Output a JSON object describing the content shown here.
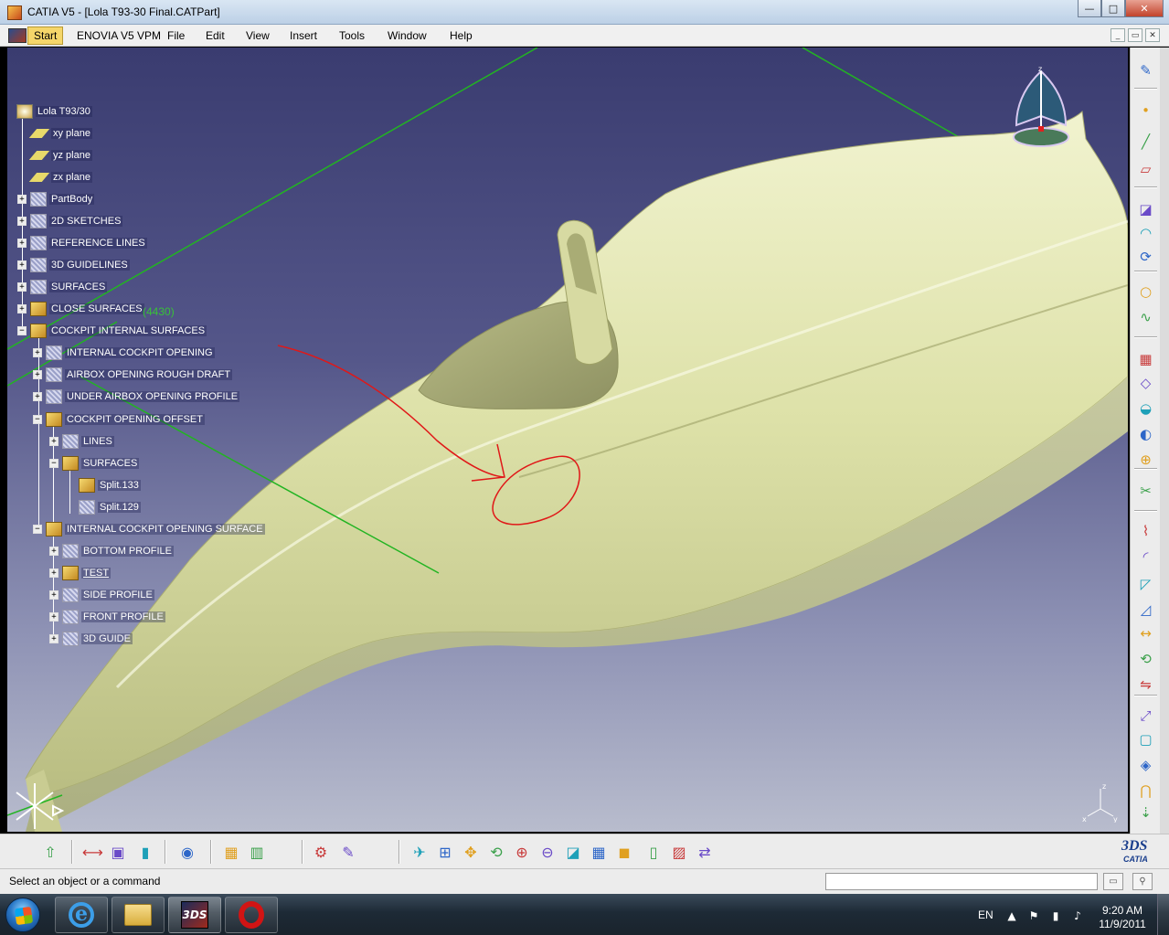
{
  "window": {
    "title": "CATIA V5 - [Lola T93-30 Final.CATPart]",
    "controls": {
      "minimize": "—",
      "maximize": "□",
      "close": "✕"
    }
  },
  "menubar": {
    "items": [
      "Start",
      "ENOVIA V5 VPM",
      "File",
      "Edit",
      "View",
      "Insert",
      "Tools",
      "Window",
      "Help"
    ],
    "doc_controls": [
      "_",
      "▭",
      "✕"
    ]
  },
  "spec_tree": {
    "root": "Lola T93/30",
    "nodes": [
      {
        "label": "xy plane",
        "type": "plane"
      },
      {
        "label": "yz plane",
        "type": "plane"
      },
      {
        "label": "zx plane",
        "type": "plane"
      },
      {
        "label": "PartBody",
        "type": "body",
        "expander": "+"
      },
      {
        "label": "2D SKETCHES",
        "type": "geoset-hatched",
        "expander": "+"
      },
      {
        "label": "REFERENCE LINES",
        "type": "geoset-hatched",
        "expander": "+"
      },
      {
        "label": "3D GUIDELINES",
        "type": "geoset-hatched",
        "expander": "+"
      },
      {
        "label": "SURFACES",
        "type": "geoset-hatched",
        "expander": "+"
      },
      {
        "label": "CLOSE SURFACES",
        "type": "geoset",
        "expander": "+"
      },
      {
        "label": "COCKPIT INTERNAL SURFACES",
        "type": "geoset",
        "expander": "−"
      },
      {
        "label": "INTERNAL COCKPIT OPENING",
        "type": "geoset-hatched",
        "expander": "+"
      },
      {
        "label": "AIRBOX OPENING ROUGH DRAFT",
        "type": "geoset-hatched",
        "expander": "+"
      },
      {
        "label": "UNDER AIRBOX OPENING PROFILE",
        "type": "geoset-hatched",
        "expander": "+"
      },
      {
        "label": "COCKPIT OPENING OFFSET",
        "type": "geoset",
        "expander": "−"
      },
      {
        "label": "LINES",
        "type": "geoset-hatched",
        "expander": "+"
      },
      {
        "label": "SURFACES",
        "type": "geoset",
        "expander": "−"
      },
      {
        "label": "Split.133",
        "type": "feature"
      },
      {
        "label": "Split.129",
        "type": "feature-hatched"
      },
      {
        "label": "INTERNAL COCKPIT OPENING SURFACE",
        "type": "geoset",
        "expander": "−"
      },
      {
        "label": "BOTTOM PROFILE",
        "type": "geoset-hatched",
        "expander": "+"
      },
      {
        "label": "TEST",
        "type": "geoset",
        "expander": "+"
      },
      {
        "label": "SIDE PROFILE",
        "type": "geoset-hatched",
        "expander": "+"
      },
      {
        "label": "FRONT PROFILE",
        "type": "geoset-hatched",
        "expander": "+"
      },
      {
        "label": "3D GUIDE",
        "type": "geoset-hatched",
        "expander": "+"
      }
    ],
    "overlay_count": "(4430)"
  },
  "viewport": {
    "compass_label": "z",
    "axis_labels": {
      "z": "z",
      "x": "x",
      "y": "y"
    },
    "colors": {
      "surface": "#e2e6b0",
      "guide_lines": "#22b422",
      "annotation": "#e01818",
      "bg_top": "#3a3c70",
      "bg_bottom": "#b8bccd"
    }
  },
  "right_toolbar": {
    "icons": [
      "sketch-icon",
      "point-icon",
      "line-icon",
      "plane-icon",
      "extrude-icon",
      "revolve-icon",
      "sweep-icon",
      "circle-icon",
      "spline-icon",
      "fill-icon",
      "loft-icon",
      "blend-icon",
      "offset-icon",
      "join-icon",
      "split-icon",
      "trim-icon",
      "fillet-icon",
      "chamfer-icon",
      "draft-icon",
      "translate-icon",
      "rotate-icon",
      "symmetry-icon",
      "scaling-icon",
      "boundary-icon",
      "extract-icon",
      "intersect-icon",
      "project-icon",
      "analysis-icon"
    ]
  },
  "bottom_toolbar": {
    "icons": [
      "update-icon",
      "measure-icon",
      "inertia-icon",
      "bottle-icon",
      "camera-icon",
      "catalog-icon",
      "table-icon",
      "tools-palette-icon",
      "knowledge-icon",
      "fly-icon",
      "fit-all-icon",
      "pan-icon",
      "rotate-view-icon",
      "zoom-in-icon",
      "zoom-out-icon",
      "normal-view-icon",
      "multi-view-icon",
      "iso-view-icon",
      "shading-icon",
      "hide-show-icon",
      "swap-space-icon"
    ],
    "brand": {
      "mark": "3DS",
      "word": "CATIA"
    }
  },
  "statusbar": {
    "message": "Select an object or a command",
    "command_value": ""
  },
  "taskbar": {
    "apps": [
      "internet-explorer",
      "windows-explorer",
      "catia",
      "opera"
    ],
    "language": "EN",
    "time": "9:20 AM",
    "date": "11/9/2011"
  }
}
